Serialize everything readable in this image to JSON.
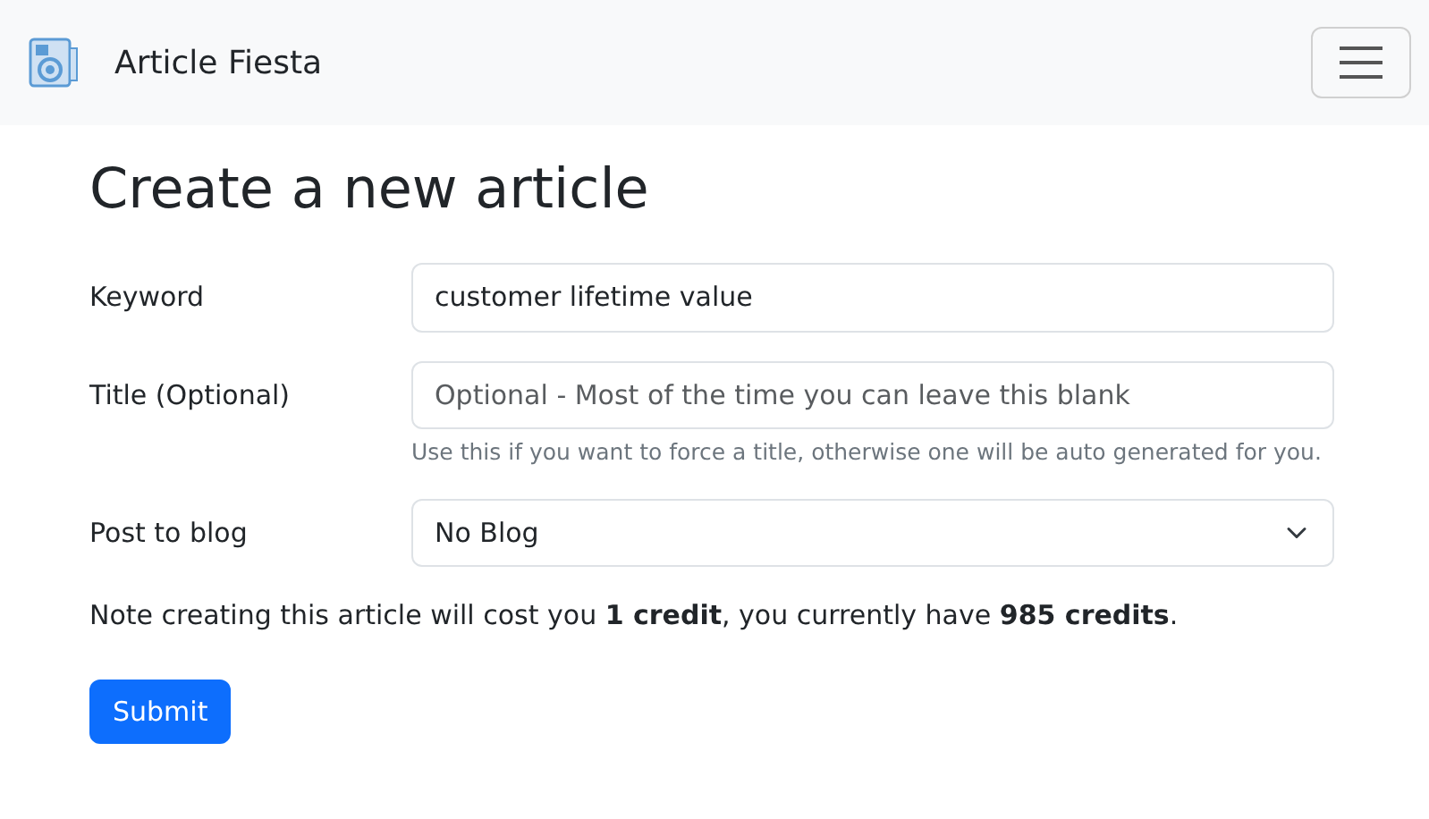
{
  "navbar": {
    "brand": "Article Fiesta"
  },
  "heading": "Create a new article",
  "fields": [
    {
      "kind": "text",
      "label": "Keyword",
      "value": "customer lifetime value"
    },
    {
      "kind": "text",
      "label": "Title (Optional)",
      "placeholder": "Optional - Most of the time you can leave this blank",
      "help": "Use this if you want to force a title, otherwise one will be auto generated for you."
    },
    {
      "kind": "select",
      "label": "Post to blog",
      "value": "No Blog"
    }
  ],
  "note": "Note creating this article will cost you **1 credit**, you currently have **985 credits**.",
  "submit": "Submit"
}
